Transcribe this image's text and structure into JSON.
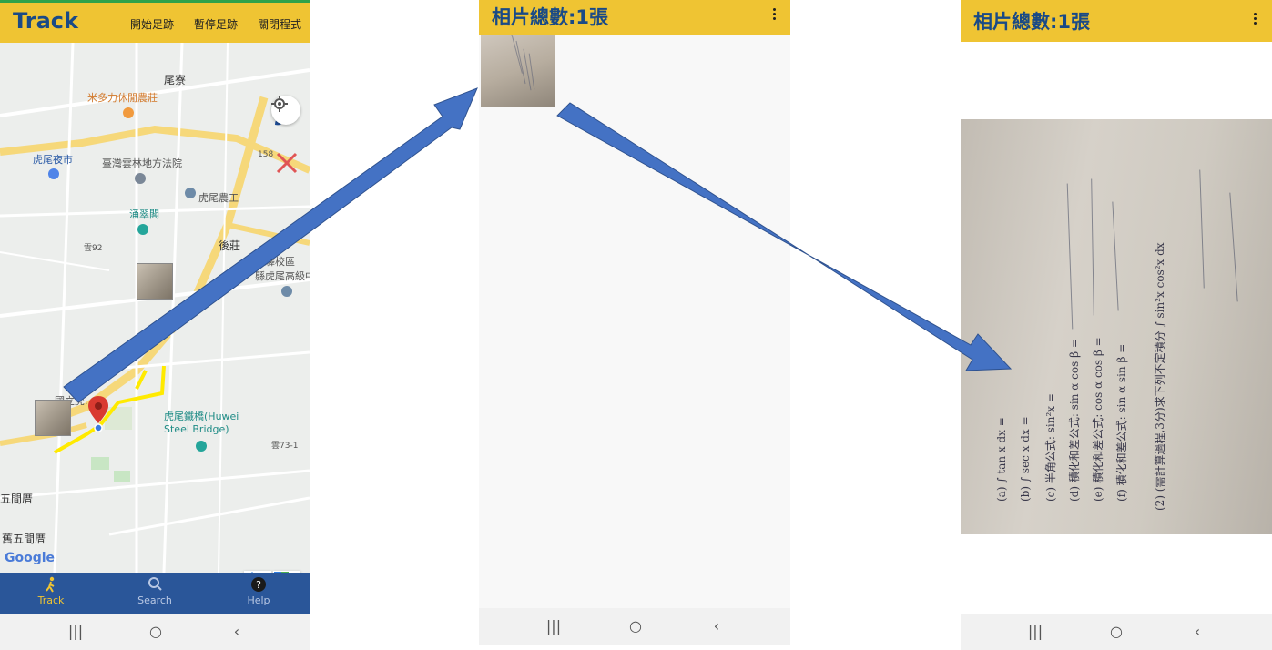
{
  "screen_map": {
    "app_title": "Track",
    "menu": [
      "開始足跡",
      "暫停足跡",
      "關閉程式"
    ],
    "map_labels": {
      "farm": "米多力休閒農莊",
      "weiwei": "尾寮",
      "night_market": "虎尾夜市",
      "court": "臺灣雲林地方法院",
      "tongcui": "涌翠閣",
      "huwei_nonggong": "虎尾農工",
      "houzhuang": "後莊",
      "school": "水驛校區\n縣虎尾高級中",
      "university": "國立虎...",
      "bridge": "虎尾鐵橋(Huwei\nSteel Bridge)",
      "wujianli": "五間厝",
      "old_wujianli": "舊五間厝",
      "road_73": "雲73-1",
      "road_92": "雲92",
      "road_158": "158"
    },
    "google": "Google",
    "nav": [
      {
        "label": "Track",
        "icon": "walk-icon"
      },
      {
        "label": "Search",
        "icon": "search-icon"
      },
      {
        "label": "Help",
        "icon": "help-icon"
      }
    ]
  },
  "screen_gallery": {
    "title": "相片總數:1張"
  },
  "screen_photo": {
    "title": "相片總數:1張",
    "photo_lines": [
      "(a) ∫ tan x dx =",
      "(b) ∫ sec x dx =",
      "(c) 半角公式: sin²x =",
      "(d) 積化和差公式: sin α cos β =",
      "(e) 積化和差公式: cos α cos β =",
      "(f) 積化和差公式: sin α sin β =",
      "(2) (需計算過程,3分)求下列不定積分 ∫ sin²x cos²x dx"
    ]
  },
  "colors": {
    "appbar": "#efc433",
    "title": "#1a4a86",
    "bottomnav": "#2a5699",
    "arrow": "#4472c4"
  }
}
